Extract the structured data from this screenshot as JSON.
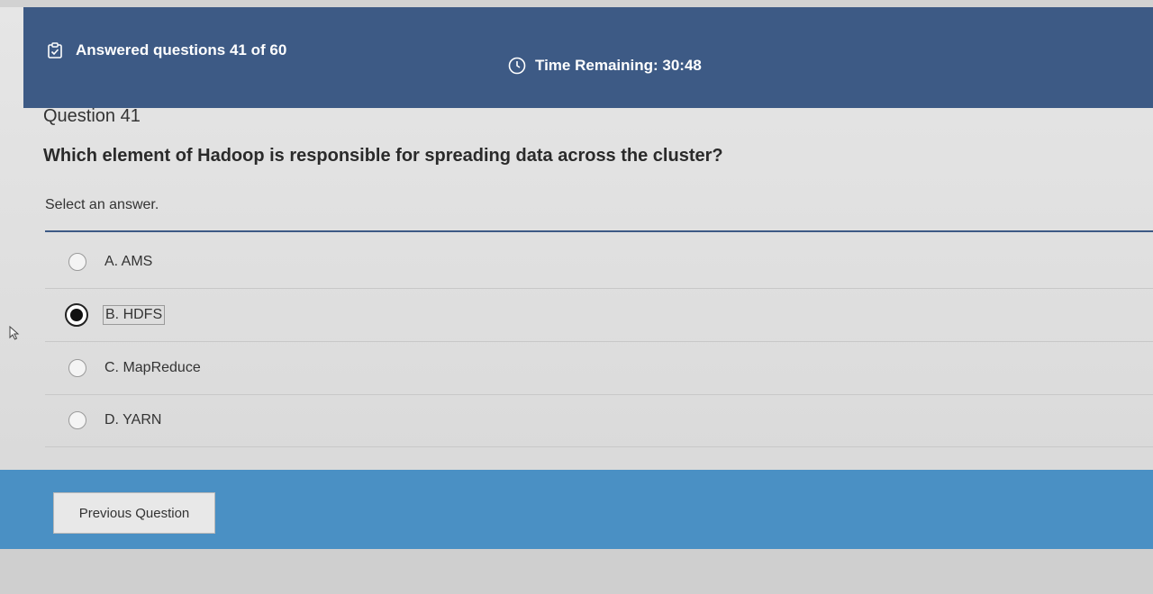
{
  "header": {
    "answered_text": "Answered questions 41 of 60",
    "answered_icon": "clipboard-check-icon",
    "timer_text": "Time Remaining: 30:48",
    "timer_icon": "clock-icon",
    "background_color": "#3d5a85"
  },
  "question": {
    "number_label": "Question 41",
    "text": "Which element of Hadoop is responsible for spreading data across the cluster?",
    "instruction": "Select an answer."
  },
  "options": [
    {
      "label": "A. AMS",
      "selected": false
    },
    {
      "label": "B. HDFS",
      "selected": true
    },
    {
      "label": "C. MapReduce",
      "selected": false
    },
    {
      "label": "D. YARN",
      "selected": false
    }
  ],
  "footer": {
    "previous_label": "Previous Question",
    "background_color": "#4a90c4"
  }
}
